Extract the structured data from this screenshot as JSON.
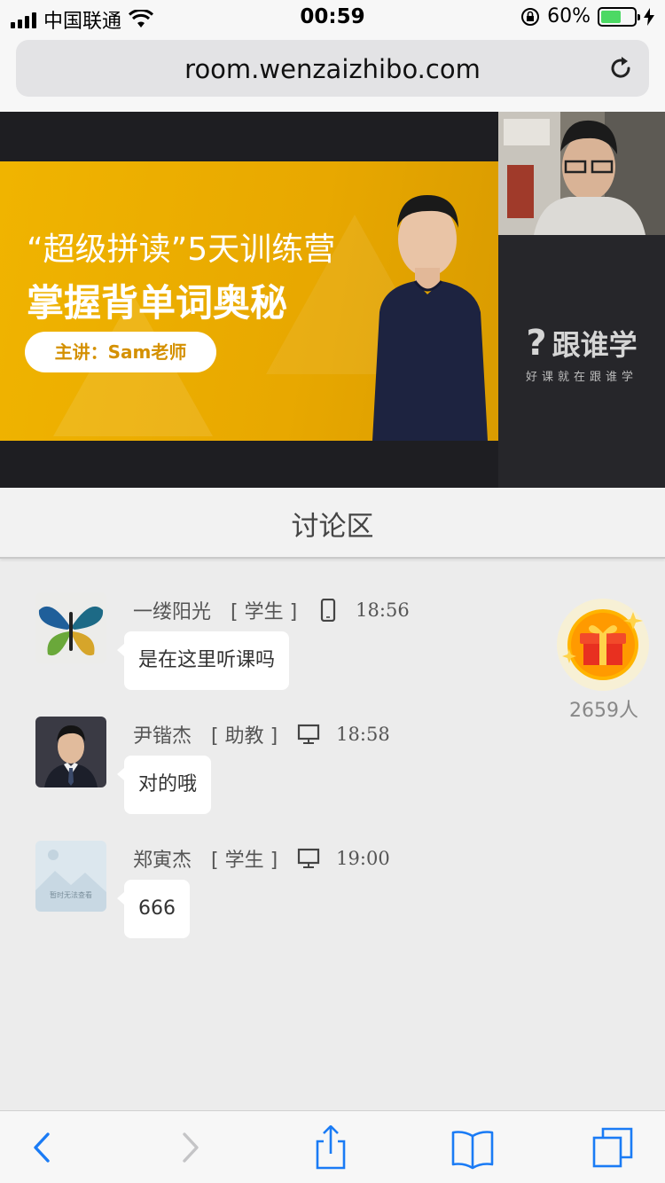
{
  "status_bar": {
    "carrier": "中国联通",
    "time": "00:59",
    "battery_percent": "60%",
    "battery_level": 0.6,
    "icons": [
      "signal-icon",
      "wifi-icon",
      "orientation-lock-icon",
      "battery-icon",
      "charging-icon"
    ]
  },
  "browser": {
    "url": "room.wenzaizhibo.com",
    "reload_icon": "reload-icon"
  },
  "banner": {
    "line1": "“超级拼读”5天训练营",
    "line2": "掌握背单词奥秘",
    "pill": "主讲：Sam老师"
  },
  "brand": {
    "name": "跟谁学",
    "slogan": "好课就在跟谁学"
  },
  "discussion": {
    "title": "讨论区",
    "messages": [
      {
        "name": "一缕阳光",
        "role": "[ 学生 ]",
        "device": "phone-icon",
        "time": "18:56",
        "text": "是在这里听课吗"
      },
      {
        "name": "尹锴杰",
        "role": "[ 助教 ]",
        "device": "desktop-icon",
        "time": "18:58",
        "text": "对的哦"
      },
      {
        "name": "郑寅杰",
        "role": "[ 学生 ]",
        "device": "desktop-icon",
        "time": "19:00",
        "text": "666"
      }
    ],
    "placeholder_avatar_text": "暂时无法查看"
  },
  "gift": {
    "count": "2659人",
    "icon": "gift-icon"
  },
  "toolbar": {
    "icons": [
      "back-icon",
      "forward-icon",
      "share-icon",
      "bookmarks-icon",
      "tabs-icon"
    ]
  },
  "colors": {
    "banner_yellow": "#f0b400",
    "dark_bg": "#1e1e22",
    "ios_blue": "#1a7bf5",
    "battery_green": "#4cd964"
  }
}
